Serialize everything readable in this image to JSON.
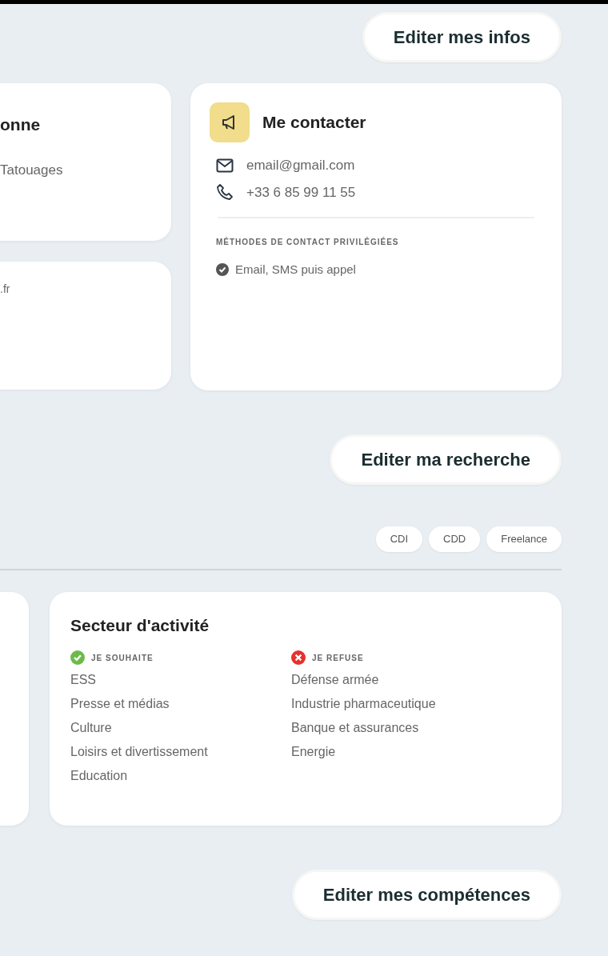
{
  "profile": {
    "edit_button": "Editer mes infos",
    "left_cards": [
      {
        "title": "onne",
        "text": "Tatouages"
      },
      {
        "text": ".fr"
      }
    ],
    "contact": {
      "title": "Me contacter",
      "items": [
        {
          "kind": "email",
          "text": "email@gmail.com"
        },
        {
          "kind": "phone",
          "text": "+33 6 85 99 11 55"
        }
      ],
      "preferred_heading": "MÉTHODES DE CONTACT PRIVILÉGIÉES",
      "preferred": "Email, SMS puis appel"
    }
  },
  "search": {
    "edit_button": "Editer ma recherche",
    "contract_types": [
      "CDI",
      "CDD",
      "Freelance"
    ],
    "sector": {
      "title": "Secteur d'activité",
      "columns": [
        {
          "kind": "wanted",
          "heading": "JE SOUHAITE",
          "items": [
            "ESS",
            "Presse et médias",
            "Culture",
            "Loisirs et divertissement",
            "Education"
          ]
        },
        {
          "kind": "refused",
          "heading": "JE REFUSE",
          "items": [
            "Défense armée",
            "Industrie pharmaceutique",
            "Banque et assurances",
            "Energie"
          ]
        }
      ]
    }
  },
  "skills": {
    "edit_button": "Editer mes compétences"
  }
}
